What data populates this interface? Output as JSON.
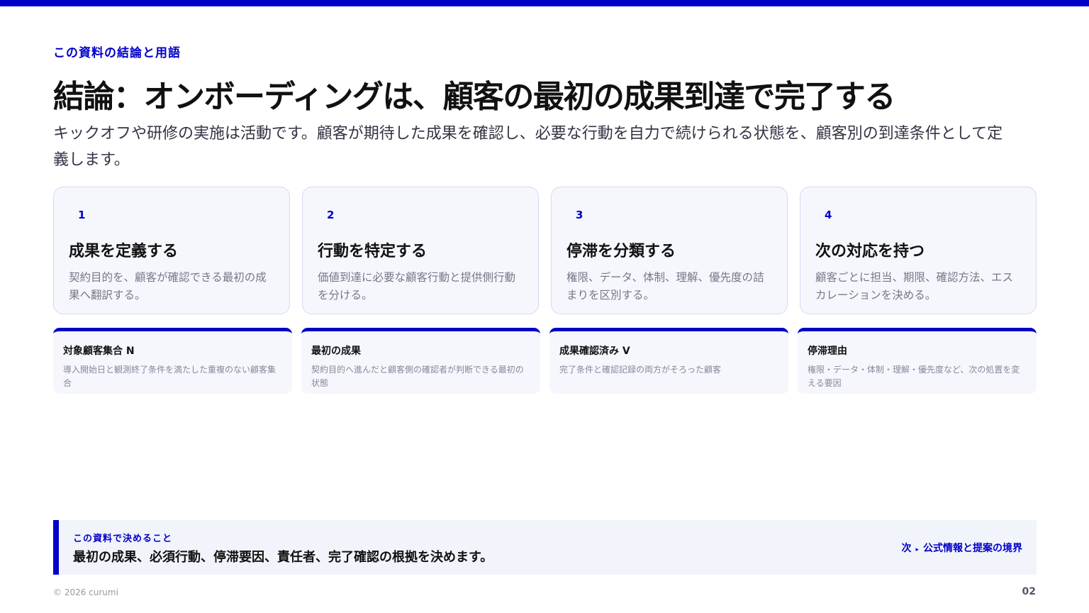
{
  "header": {
    "eyebrow": "この資料の結論と用語",
    "title": "結論：オンボーディングは、顧客の最初の成果到達で完了する",
    "lead": "キックオフや研修の実施は活動です。顧客が期待した成果を確認し、必要な行動を自力で続けられる状態を、顧客別の到達条件として定義します。"
  },
  "steps": [
    {
      "num": "1",
      "title": "成果を定義する",
      "desc": "契約目的を、顧客が確認できる最初の成果へ翻訳する。"
    },
    {
      "num": "2",
      "title": "行動を特定する",
      "desc": "価値到達に必要な顧客行動と提供側行動を分ける。"
    },
    {
      "num": "3",
      "title": "停滞を分類する",
      "desc": "権限、データ、体制、理解、優先度の詰まりを区別する。"
    },
    {
      "num": "4",
      "title": "次の対応を持つ",
      "desc": "顧客ごとに担当、期限、確認方法、エスカレーションを決める。"
    }
  ],
  "terms": [
    {
      "title": "対象顧客集合 N",
      "desc": "導入開始日と観測終了条件を満たした重複のない顧客集合"
    },
    {
      "title": "最初の成果",
      "desc": "契約目的へ進んだと顧客側の確認者が判断できる最初の状態"
    },
    {
      "title": "成果確認済み V",
      "desc": "完了条件と確認記録の両方がそろった顧客"
    },
    {
      "title": "停滞理由",
      "desc": "権限・データ・体制・理解・優先度など、次の処置を変える要因"
    }
  ],
  "decide": {
    "label": "この資料で決めること",
    "text": "最初の成果、必須行動、停滞要因、責任者、完了確認の根拠を決めます。",
    "next_prefix": "次",
    "next_arrow": "▸",
    "next_label": "公式情報と提案の境界"
  },
  "footer": {
    "copyright": "© 2026 curumi",
    "page": "02"
  },
  "colors": {
    "accent": "#0000c8",
    "card_bg": "#f5f7fd",
    "card_border": "#d6d8f4"
  }
}
